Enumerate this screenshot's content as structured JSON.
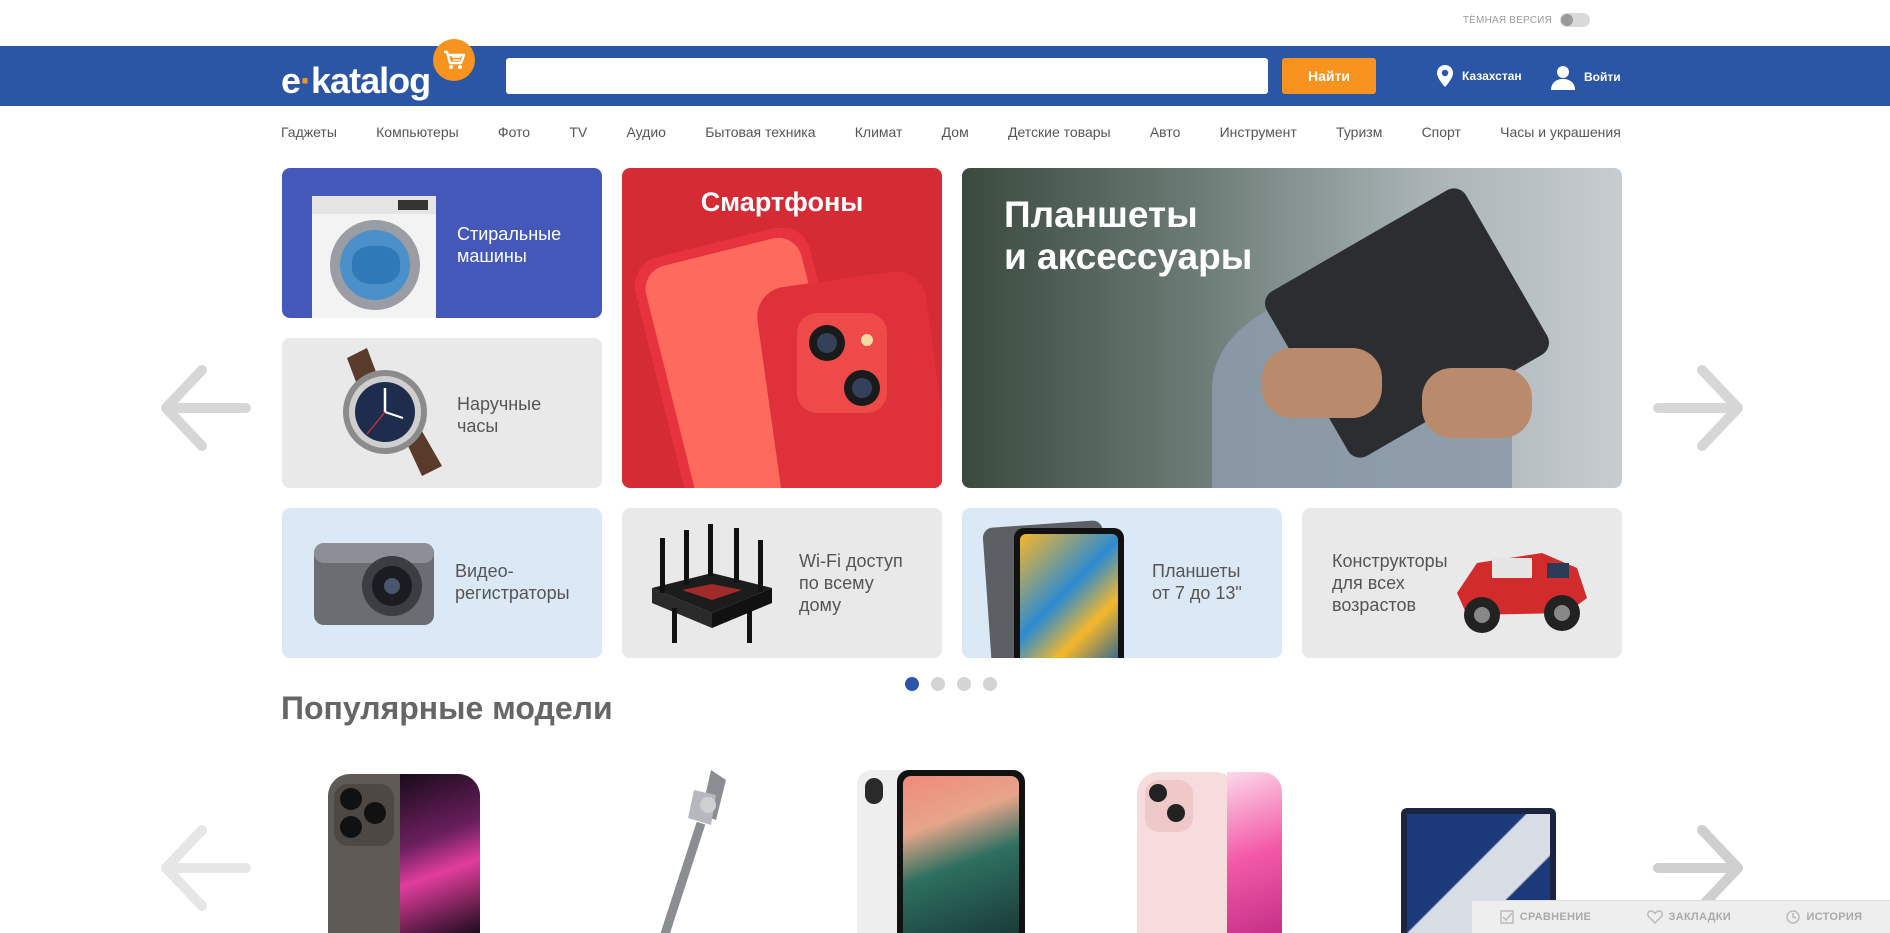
{
  "topbar": {
    "dark_mode_label": "ТЁМНАЯ ВЕРСИЯ"
  },
  "header": {
    "logo_prefix": "e",
    "logo_dot": "·",
    "logo_suffix": "katalog",
    "search_value": "",
    "search_button": "Найти",
    "location": "Казахстан",
    "login": "Войти"
  },
  "nav": {
    "items": [
      "Гаджеты",
      "Компьютеры",
      "Фото",
      "TV",
      "Аудио",
      "Бытовая техника",
      "Климат",
      "Дом",
      "Детские товары",
      "Авто",
      "Инструмент",
      "Туризм",
      "Спорт",
      "Часы и украшения"
    ]
  },
  "banners": {
    "washing": "Стиральные\nмашины",
    "watches": "Наручные\nчасы",
    "smartphones": "Смартфоны",
    "tablets": "Планшеты\nи аксессуары",
    "dashcams": "Видео-\nрегистраторы",
    "wifi": "Wi-Fi доступ\nпо всему\nдому",
    "tablets_size": "Планшеты\nот 7 до 13\"",
    "constructors": "Конструкторы\nдля всех\nвозрастов"
  },
  "carousel": {
    "pages": 4,
    "active": 1
  },
  "popular": {
    "title": "Популярные модели",
    "products": [
      "smartphone-graphite",
      "stick-vacuum",
      "tablet-white",
      "smartphone-pink",
      "laptop-dark"
    ]
  },
  "bottom_bar": {
    "compare": "СРАВНЕНИЕ",
    "bookmarks": "ЗАКЛАДКИ",
    "history": "ИСТОРИЯ"
  },
  "colors": {
    "brand_blue": "#2b56a6",
    "accent_orange": "#f7931e",
    "tile_blue": "#4358b8",
    "tile_red": "#d52b35",
    "tile_light_blue": "#dbe8f5",
    "tile_gray": "#e9e9e9"
  }
}
